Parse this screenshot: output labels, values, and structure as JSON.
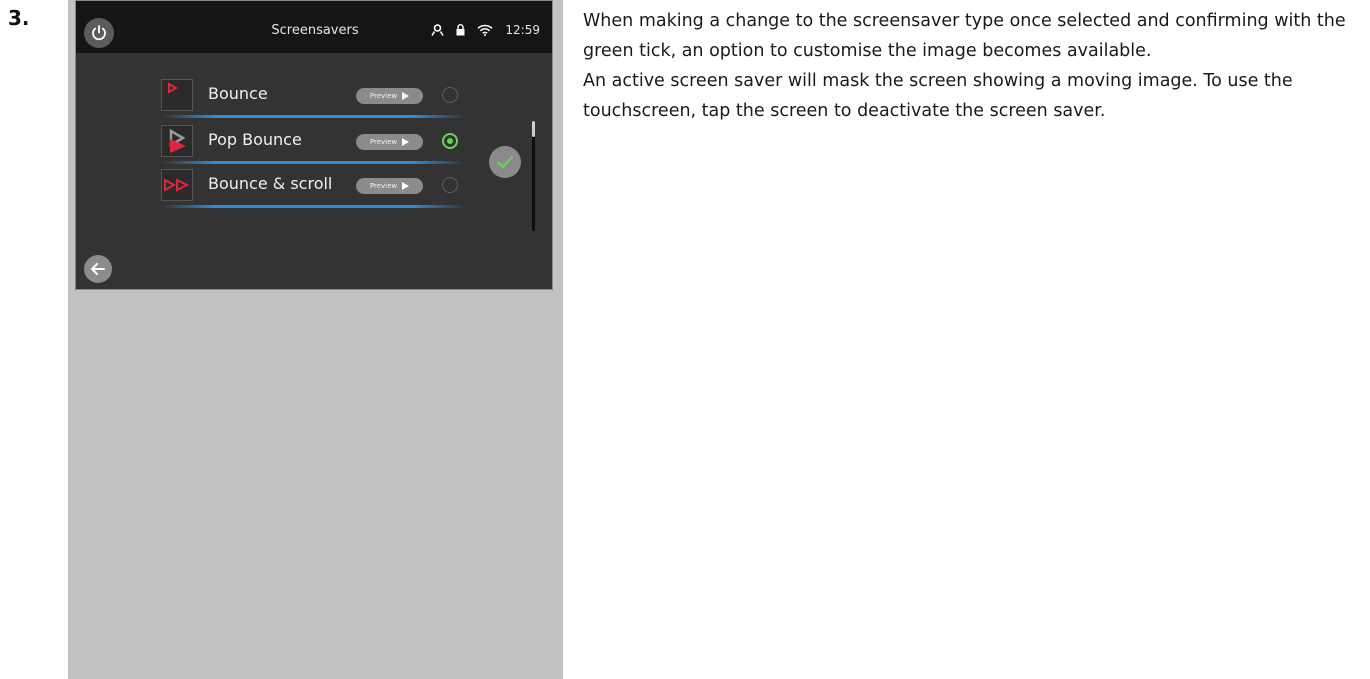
{
  "step_number": "3.",
  "screen": {
    "title": "Screensavers",
    "clock": "12:59",
    "status_icons": [
      "user-icon",
      "lock-icon",
      "wifi-icon"
    ],
    "power_icon": "power-icon",
    "back_icon": "back-arrow-icon",
    "confirm_icon": "check-icon",
    "screensavers": [
      {
        "name": "Bounce",
        "preview_label": "Preview",
        "selected": false,
        "thumb_icon": "bounce-icon"
      },
      {
        "name": "Pop Bounce",
        "preview_label": "Preview",
        "selected": true,
        "thumb_icon": "pop-bounce-icon"
      },
      {
        "name": "Bounce & scroll",
        "preview_label": "Preview",
        "selected": false,
        "thumb_icon": "bounce-scroll-icon"
      }
    ]
  },
  "description": {
    "paragraph1": "When making a change to the screensaver type once selected and confirming with the green tick, an option to customise the image becomes available.",
    "paragraph2": "An active screen saver will mask the screen showing a moving image. To use the touchscreen, tap the screen to deactivate the screen saver."
  },
  "colors": {
    "accent_blue": "#2e8ede",
    "selected_green": "#6ad15a",
    "thumb_red": "#e0253d"
  }
}
